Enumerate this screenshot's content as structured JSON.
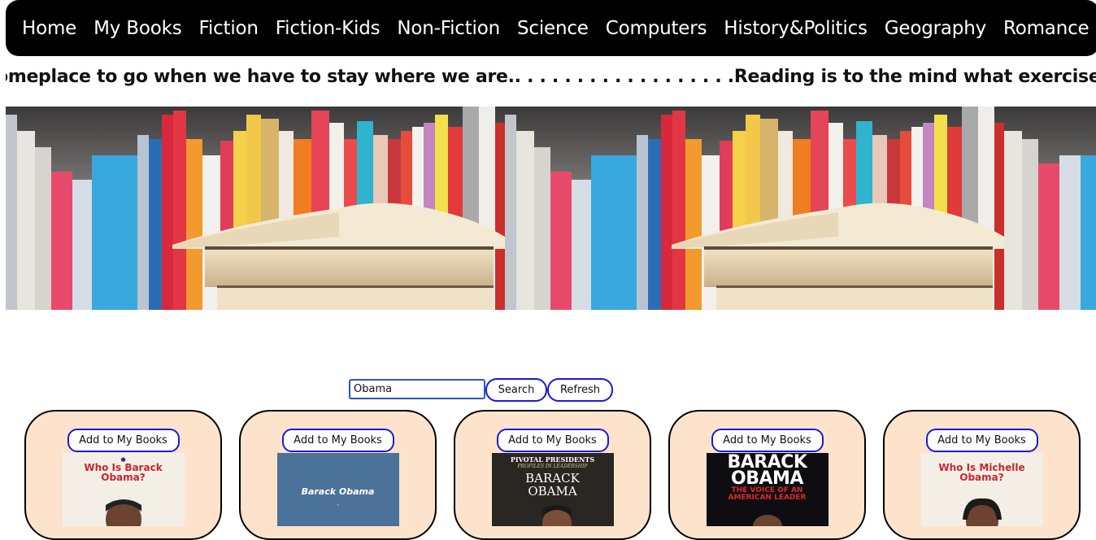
{
  "nav": {
    "items": [
      "Home",
      "My Books",
      "Fiction",
      "Fiction-Kids",
      "Non-Fiction",
      "Science",
      "Computers",
      "History&Politics",
      "Geography",
      "Romance"
    ]
  },
  "marquee": {
    "text": "omeplace to go when we have to stay where we are.. . . . . . . . . . . . . . . . . .Reading is to the mind what exercise is to the"
  },
  "search": {
    "value": "Obama",
    "search_label": "Search",
    "refresh_label": "Refresh"
  },
  "books": [
    {
      "add_label": "Add to My Books",
      "cover_title": "Who Is Barack Obama?",
      "cover_color": "#f3efe6",
      "title_color": "#c4282e"
    },
    {
      "add_label": "Add to My Books",
      "cover_title": "Barack Obama",
      "cover_color": "#4b7399",
      "title_color": "#ffffff"
    },
    {
      "add_label": "Add to My Books",
      "cover_title": "BARACK OBAMA",
      "cover_series": "PIVOTAL PRESIDENTS",
      "cover_subtitle": "PROFILES IN LEADERSHIP",
      "cover_color": "#2a2622",
      "title_color": "#ffffff"
    },
    {
      "add_label": "Add to My Books",
      "cover_title": "BARACK OBAMA",
      "cover_subtitle": "THE VOICE OF AN AMERICAN LEADER",
      "cover_color": "#0e0e12",
      "title_color": "#ffffff",
      "subtitle_color": "#e0262a"
    },
    {
      "add_label": "Add to My Books",
      "cover_title": "Who Is Michelle Obama?",
      "cover_color": "#f3efe6",
      "title_color": "#c4282e"
    }
  ],
  "colors": {
    "nav_bg": "#000000",
    "card_bg": "#fde3cc",
    "button_border": "#1a1ad6"
  }
}
